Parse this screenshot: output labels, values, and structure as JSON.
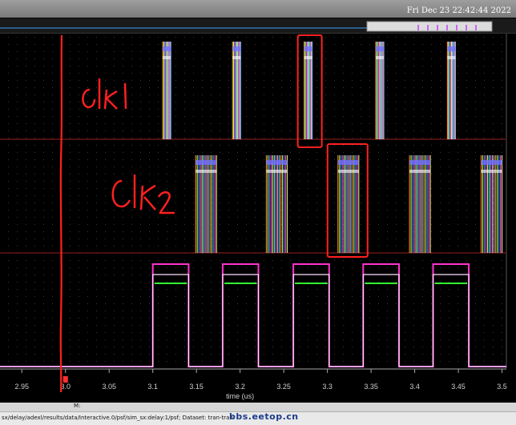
{
  "window": {
    "datetime": "Fri Dec 23 22:42:44 2022"
  },
  "annotations": {
    "clk1_label": "clk1",
    "clk2_label": "Clk2"
  },
  "cursor": {
    "marker_label": "M:"
  },
  "statusbar": {
    "path_text": "sx/delay/adexl/results/data/Interactive.0/psf/sim_sx:delay:1/psf; Dataset: tran-tran"
  },
  "watermark": "bbs.eetop.cn",
  "colors": {
    "background": "#000000",
    "clk1_trace": "#ff9a2a",
    "clk2_trace": "#b8ff4a",
    "pulse_magenta": "#ff33cc",
    "pulse_white": "#ffe0ff",
    "pulse_green": "#33ff33",
    "annotation_red": "#ff2020",
    "divider": "#7a1a1a"
  },
  "chart_data": {
    "type": "line",
    "xlabel": "time (us)",
    "xlim": [
      2.925,
      3.505
    ],
    "x_ticks": [
      "2.95",
      "3.0",
      "3.05",
      "3.1",
      "3.15",
      "3.2",
      "3.25",
      "3.3",
      "3.35",
      "3.4",
      "3.45",
      "3.5"
    ],
    "x_tick_values": [
      2.95,
      3.0,
      3.05,
      3.1,
      3.15,
      3.2,
      3.25,
      3.3,
      3.35,
      3.4,
      3.45,
      3.5
    ],
    "cursor_x": 3.0,
    "clk1_bursts": [
      3.116,
      3.196,
      3.278,
      3.36,
      3.442
    ],
    "clk2_bursts": [
      3.161,
      3.242,
      3.324,
      3.406,
      3.488
    ],
    "pulses": [
      {
        "start": 3.1,
        "end": 3.141
      },
      {
        "start": 3.18,
        "end": 3.221
      },
      {
        "start": 3.261,
        "end": 3.302
      },
      {
        "start": 3.341,
        "end": 3.382
      },
      {
        "start": 3.421,
        "end": 3.462
      }
    ],
    "highlighted_clk1_burst": 3.278,
    "highlighted_clk2_burst": 3.324
  }
}
